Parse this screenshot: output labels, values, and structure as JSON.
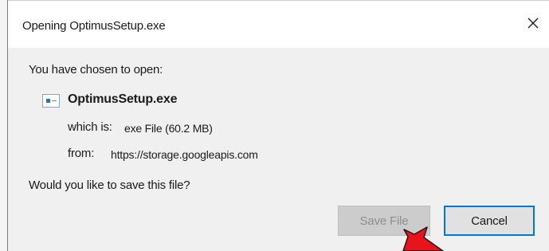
{
  "window": {
    "title": "Opening OptimusSetup.exe",
    "close_glyph": "✕"
  },
  "content": {
    "chosen_label": "You have chosen to open:",
    "file_icon": "exe-file-icon",
    "file_name": "OptimusSetup.exe",
    "which_is_label": "which is:",
    "which_is_value": "exe File (60.2 MB)",
    "from_label": "from:",
    "from_value": "https://storage.googleapis.com",
    "question": "Would you like to save this file?"
  },
  "buttons": {
    "save_label": "Save File",
    "cancel_label": "Cancel"
  },
  "colors": {
    "focus_accent": "#0078d7",
    "pointer_arrow": "#e8141b"
  }
}
